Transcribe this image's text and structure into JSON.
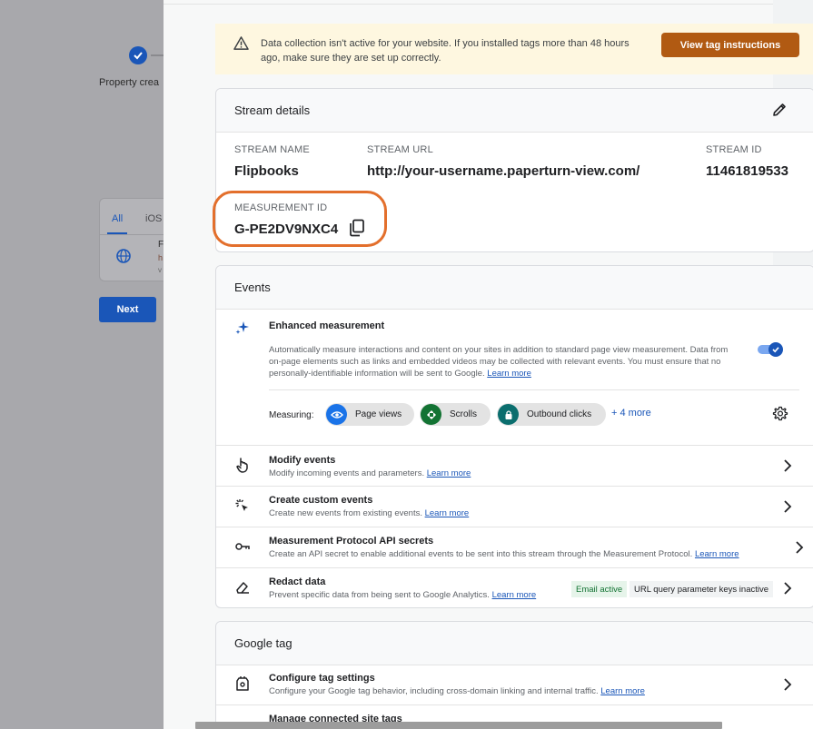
{
  "background": {
    "step_label": "Property crea",
    "tabs": {
      "all": "All",
      "ios": "iOS"
    },
    "row_title": "F",
    "row_sub": "h",
    "row_sub2": "v",
    "next_label": "Next"
  },
  "alert": {
    "text": "Data collection isn't active for your website. If you installed tags more than 48 hours ago, make sure they are set up correctly.",
    "button": "View tag instructions",
    "icon": "warning-icon"
  },
  "stream_details": {
    "title": "Stream details",
    "stream_name_label": "STREAM NAME",
    "stream_name": "Flipbooks",
    "stream_url_label": "STREAM URL",
    "stream_url": "http://your-username.paperturn-view.com/",
    "stream_id_label": "STREAM ID",
    "stream_id": "11461819533",
    "measurement_id_label": "MEASUREMENT ID",
    "measurement_id": "G-PE2DV9NXC4",
    "highlight_color": "#e36f2c"
  },
  "events": {
    "title": "Events",
    "enhanced": {
      "title": "Enhanced measurement",
      "desc": "Automatically measure interactions and content on your sites in addition to standard page view measurement. Data from on-page elements such as links and embedded videos may be collected with relevant events. You must ensure that no personally-identifiable information will be sent to Google.",
      "learn_more": "Learn more",
      "toggle_on": true,
      "measuring_label": "Measuring:",
      "chips": [
        {
          "label": "Page views",
          "color": "#1a73e8",
          "icon": "eye-icon"
        },
        {
          "label": "Scrolls",
          "color": "#137333",
          "icon": "scroll-icon"
        },
        {
          "label": "Outbound clicks",
          "color": "#0b6e6e",
          "icon": "lock-icon"
        }
      ],
      "more": "+ 4 more"
    },
    "rows": [
      {
        "title": "Modify events",
        "desc": "Modify incoming events and parameters.",
        "link": "Learn more"
      },
      {
        "title": "Create custom events",
        "desc": "Create new events from existing events.",
        "link": "Learn more"
      },
      {
        "title": "Measurement Protocol API secrets",
        "desc": "Create an API secret to enable additional events to be sent into this stream through the Measurement Protocol.",
        "link": "Learn more"
      },
      {
        "title": "Redact data",
        "desc": "Prevent specific data from being sent to Google Analytics.",
        "link": "Learn more",
        "badge_active": "Email active",
        "badge_inactive": "URL query parameter keys inactive"
      }
    ]
  },
  "google_tag": {
    "title": "Google tag",
    "rows": [
      {
        "title": "Configure tag settings",
        "desc": "Configure your Google tag behavior, including cross-domain linking and internal traffic.",
        "link": "Learn more"
      },
      {
        "title": "Manage connected site tags"
      }
    ]
  }
}
